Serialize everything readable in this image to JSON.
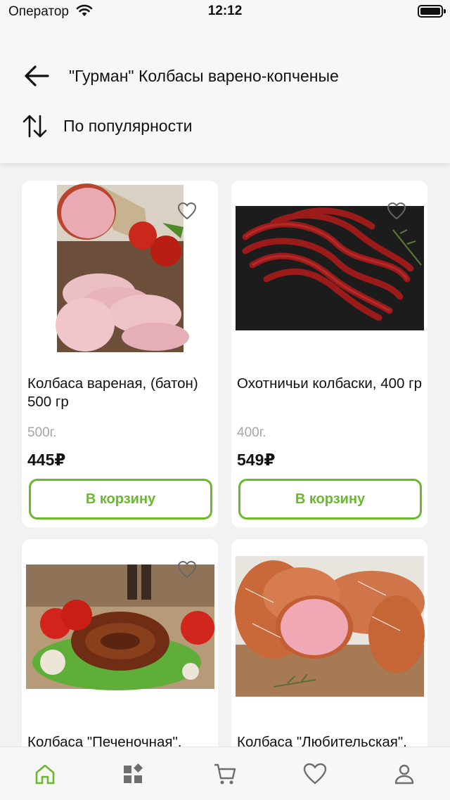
{
  "status_bar": {
    "carrier": "Оператор",
    "time": "12:12"
  },
  "header": {
    "title": "\"Гурман\" Колбасы варено-копченые",
    "sort_label": "По популярности"
  },
  "products": [
    {
      "name": "Колбаса вареная, (батон) 500 гр",
      "weight": "500г.",
      "price": "445₽",
      "button": "В корзину",
      "image": "boiled-sausage-slices-photo"
    },
    {
      "name": "Охотничьи колбаски, 400 гр",
      "weight": "400г.",
      "price": "549₽",
      "button": "В корзину",
      "image": "hunting-sausages-photo"
    },
    {
      "name": "Колбаса \"Печеночная\",",
      "image": "liver-sausage-ring-photo"
    },
    {
      "name": "Колбаса \"Любительская\",",
      "image": "amateur-sausage-photo"
    }
  ],
  "tabbar": {
    "active": "home",
    "accent": "#6ab82e",
    "items": [
      "home-icon",
      "catalog-icon",
      "cart-icon",
      "favorites-icon",
      "profile-icon"
    ]
  },
  "colors": {
    "accent": "#6ab82e",
    "muted": "#a6a6a6"
  }
}
